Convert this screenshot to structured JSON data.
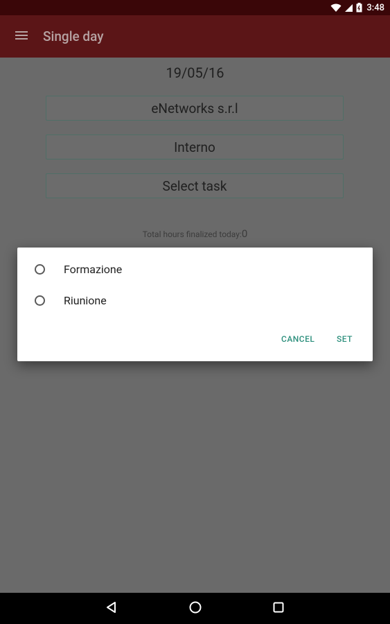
{
  "status_bar": {
    "time": "3:48",
    "icons": [
      "wifi-icon",
      "signal-icon",
      "battery-icon"
    ]
  },
  "app_bar": {
    "title": "Single day",
    "menu_icon": "hamburger-icon"
  },
  "main": {
    "date": "19/05/16",
    "company": "eNetworks s.r.l",
    "category": "Interno",
    "task": "Select task",
    "total_label": "Total hours finalized today:",
    "total_value": "0"
  },
  "dialog": {
    "options": [
      {
        "label": "Formazione",
        "selected": false
      },
      {
        "label": "Riunione",
        "selected": false
      }
    ],
    "cancel_label": "CANCEL",
    "set_label": "SET"
  },
  "nav_bar": {
    "icons": [
      "back-icon",
      "home-icon",
      "recents-icon"
    ]
  },
  "colors": {
    "status_bar": "#3a0608",
    "app_bar": "#5b1517",
    "accent": "#2c8f7c",
    "scrim_background": "#6a6a6a"
  }
}
